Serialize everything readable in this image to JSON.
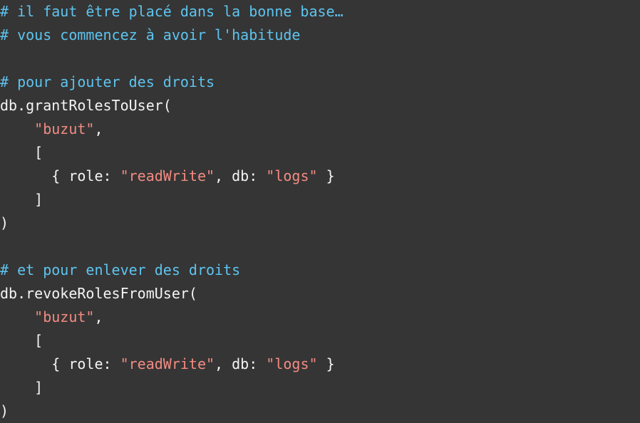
{
  "colors": {
    "background": "#353535",
    "comment": "#5ec4ef",
    "plain": "#f4f4f4",
    "string": "#f28b82"
  },
  "code": {
    "lines": [
      [
        {
          "t": "comment",
          "v": "# il faut être placé dans la bonne base…"
        }
      ],
      [
        {
          "t": "comment",
          "v": "# vous commencez à avoir l'habitude"
        }
      ],
      [],
      [
        {
          "t": "comment",
          "v": "# pour ajouter des droits"
        }
      ],
      [
        {
          "t": "plain",
          "v": "db.grantRolesToUser("
        }
      ],
      [
        {
          "t": "plain",
          "v": "    "
        },
        {
          "t": "string",
          "v": "\"buzut\""
        },
        {
          "t": "plain",
          "v": ","
        }
      ],
      [
        {
          "t": "plain",
          "v": "    ["
        }
      ],
      [
        {
          "t": "plain",
          "v": "      { role: "
        },
        {
          "t": "string",
          "v": "\"readWrite\""
        },
        {
          "t": "plain",
          "v": ", db: "
        },
        {
          "t": "string",
          "v": "\"logs\""
        },
        {
          "t": "plain",
          "v": " }"
        }
      ],
      [
        {
          "t": "plain",
          "v": "    ]"
        }
      ],
      [
        {
          "t": "plain",
          "v": ")"
        }
      ],
      [],
      [
        {
          "t": "comment",
          "v": "# et pour enlever des droits"
        }
      ],
      [
        {
          "t": "plain",
          "v": "db.revokeRolesFromUser("
        }
      ],
      [
        {
          "t": "plain",
          "v": "    "
        },
        {
          "t": "string",
          "v": "\"buzut\""
        },
        {
          "t": "plain",
          "v": ","
        }
      ],
      [
        {
          "t": "plain",
          "v": "    ["
        }
      ],
      [
        {
          "t": "plain",
          "v": "      { role: "
        },
        {
          "t": "string",
          "v": "\"readWrite\""
        },
        {
          "t": "plain",
          "v": ", db: "
        },
        {
          "t": "string",
          "v": "\"logs\""
        },
        {
          "t": "plain",
          "v": " }"
        }
      ],
      [
        {
          "t": "plain",
          "v": "    ]"
        }
      ],
      [
        {
          "t": "plain",
          "v": ")"
        }
      ]
    ]
  }
}
